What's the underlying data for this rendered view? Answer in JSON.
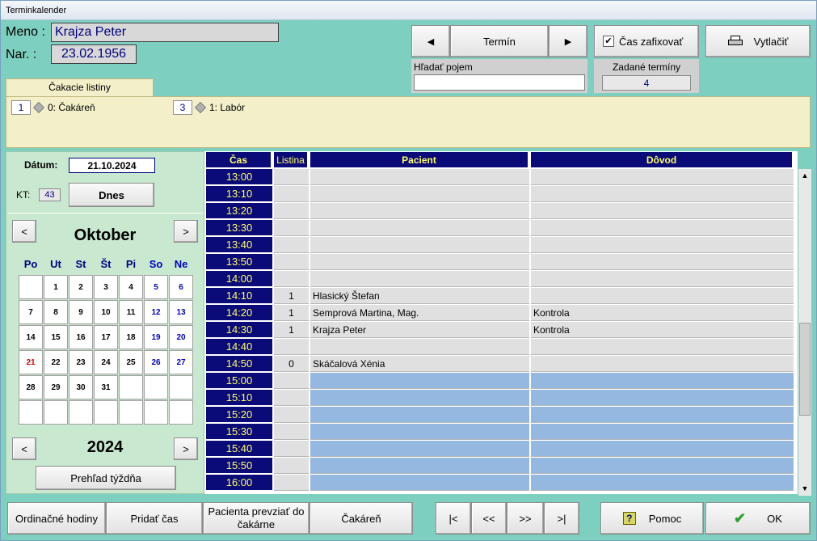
{
  "window": {
    "title": "Terminkalender"
  },
  "patient": {
    "name_label": "Meno :",
    "name": "Krajza Peter",
    "dob_label": "Nar. :",
    "dob": "23.02.1956"
  },
  "toolbar": {
    "prev_arrow": "◀",
    "termin_label": "Termín",
    "next_arrow": "▶",
    "fix_label": "Čas zafixovať",
    "fix_checked": "✔",
    "print_label": "Vytlačiť"
  },
  "search": {
    "label": "Hľadať pojem",
    "value": ""
  },
  "entered": {
    "label": "Zadané termíny",
    "count": "4"
  },
  "waiting": {
    "tab_label": "Čakacie listiny",
    "lists": [
      {
        "count": "1",
        "name": "0: Čakáreň"
      },
      {
        "count": "3",
        "name": "1: Labór"
      }
    ]
  },
  "calendar": {
    "date_label": "Dátum:",
    "date": "21.10.2024",
    "kt_label": "KT:",
    "kt": "43",
    "today_label": "Dnes",
    "month": "Oktober",
    "year": "2024",
    "prev": "<",
    "next": ">",
    "weekdays": [
      "Po",
      "Ut",
      "St",
      "Št",
      "Pi",
      "So",
      "Ne"
    ],
    "weeks": [
      [
        "",
        "1",
        "2",
        "3",
        "4",
        "5",
        "6"
      ],
      [
        "7",
        "8",
        "9",
        "10",
        "11",
        "12",
        "13"
      ],
      [
        "14",
        "15",
        "16",
        "17",
        "18",
        "19",
        "20"
      ],
      [
        "21",
        "22",
        "23",
        "24",
        "25",
        "26",
        "27"
      ],
      [
        "28",
        "29",
        "30",
        "31",
        "",
        "",
        ""
      ],
      [
        "",
        "",
        "",
        "",
        "",
        "",
        ""
      ]
    ],
    "selected_day": "21",
    "week_overview_label": "Prehľad týždňa"
  },
  "schedule": {
    "headers": {
      "time": "Čas",
      "list": "Listina",
      "patient": "Pacient",
      "reason": "Dôvod"
    },
    "rows": [
      {
        "time": "13:00",
        "list": "",
        "patient": "",
        "reason": "",
        "free": false
      },
      {
        "time": "13:10",
        "list": "",
        "patient": "",
        "reason": "",
        "free": false
      },
      {
        "time": "13:20",
        "list": "",
        "patient": "",
        "reason": "",
        "free": false
      },
      {
        "time": "13:30",
        "list": "",
        "patient": "",
        "reason": "",
        "free": false
      },
      {
        "time": "13:40",
        "list": "",
        "patient": "",
        "reason": "",
        "free": false
      },
      {
        "time": "13:50",
        "list": "",
        "patient": "",
        "reason": "",
        "free": false
      },
      {
        "time": "14:00",
        "list": "",
        "patient": "",
        "reason": "",
        "free": false
      },
      {
        "time": "14:10",
        "list": "1",
        "patient": "Hlasický Štefan",
        "reason": "",
        "free": false
      },
      {
        "time": "14:20",
        "list": "1",
        "patient": "Semprová Martina, Mag.",
        "reason": "Kontrola",
        "free": false
      },
      {
        "time": "14:30",
        "list": "1",
        "patient": "Krajza Peter",
        "reason": "Kontrola",
        "free": false
      },
      {
        "time": "14:40",
        "list": "",
        "patient": "",
        "reason": "",
        "free": false
      },
      {
        "time": "14:50",
        "list": "0",
        "patient": "Skáčalová Xénia",
        "reason": "",
        "free": false
      },
      {
        "time": "15:00",
        "list": "",
        "patient": "",
        "reason": "",
        "free": true
      },
      {
        "time": "15:10",
        "list": "",
        "patient": "",
        "reason": "",
        "free": true
      },
      {
        "time": "15:20",
        "list": "",
        "patient": "",
        "reason": "",
        "free": true
      },
      {
        "time": "15:30",
        "list": "",
        "patient": "",
        "reason": "",
        "free": true
      },
      {
        "time": "15:40",
        "list": "",
        "patient": "",
        "reason": "",
        "free": true
      },
      {
        "time": "15:50",
        "list": "",
        "patient": "",
        "reason": "",
        "free": true
      },
      {
        "time": "16:00",
        "list": "",
        "patient": "",
        "reason": "",
        "free": true
      }
    ]
  },
  "bottom": {
    "office_hours": "Ordinačné hodiny",
    "add_time": "Pridať čas",
    "take_patient": "Pacienta prevziať do čakárne",
    "waiting_room": "Čakáreň",
    "first": "|<",
    "prev": "<<",
    "next": ">>",
    "last": ">|",
    "help": "Pomoc",
    "help_icon": "?",
    "ok": "OK",
    "ok_icon": "✔"
  },
  "colors": {
    "background": "#7dcfbf",
    "header_blue": "#0a0a78",
    "header_text": "#ffff66",
    "free_slot": "#95b8e0",
    "waiting_panel": "#f2efc9",
    "calendar_panel": "#c8e8cf"
  }
}
